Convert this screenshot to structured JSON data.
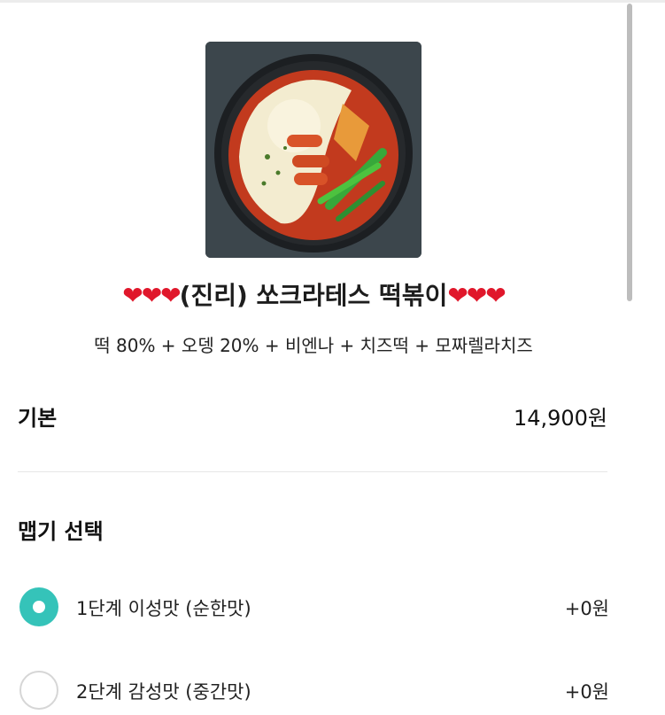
{
  "product": {
    "image_alt": "tteokbokki-with-cheese",
    "title_hearts_left": "❤❤❤",
    "title_text": "(진리) 쏘크라테스 떡볶이",
    "title_hearts_right": "❤❤❤",
    "description": "떡 80% + 오뎅 20% + 비엔나 + 치즈떡 + 모짜렐라치즈"
  },
  "base": {
    "label": "기본",
    "price": "14,900원"
  },
  "spice": {
    "title": "맵기 선택",
    "options": [
      {
        "label": "1단계 이성맛 (순한맛)",
        "price": "+0원",
        "selected": true
      },
      {
        "label": "2단계 감성맛 (중간맛)",
        "price": "+0원",
        "selected": false
      }
    ]
  },
  "colors": {
    "accent": "#35c3b9",
    "heart": "#e0172b"
  }
}
